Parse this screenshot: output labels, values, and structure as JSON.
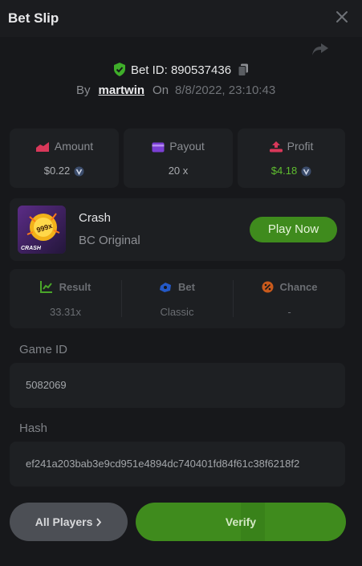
{
  "header": {
    "title": "Bet Slip"
  },
  "bet": {
    "id_text": "Bet ID: 890537436",
    "by_label": "By",
    "user": "martwin",
    "on_label": "On",
    "datetime": "8/8/2022, 23:10:43"
  },
  "stats": {
    "amount": {
      "label": "Amount",
      "value": "$0.22"
    },
    "payout": {
      "label": "Payout",
      "value": "20 x"
    },
    "profit": {
      "label": "Profit",
      "value": "$4.18"
    }
  },
  "game": {
    "name": "Crash",
    "subtitle": "BC Original",
    "thumb_badge": "999x",
    "thumb_label": "CRASH",
    "play_label": "Play Now"
  },
  "result": {
    "result": {
      "label": "Result",
      "value": "33.31x"
    },
    "bet": {
      "label": "Bet",
      "value": "Classic"
    },
    "chance": {
      "label": "Chance",
      "value": "-"
    }
  },
  "fields": {
    "game_id": {
      "label": "Game ID",
      "value": "5082069"
    },
    "hash": {
      "label": "Hash",
      "value": "ef241a203bab3e9cd951e4894dc740401fd84f61c38f6218f2"
    }
  },
  "actions": {
    "all_players": "All Players",
    "verify": "Verify"
  },
  "colors": {
    "background": "#17181b",
    "card": "#1e2023",
    "accent_green": "#3f8b1d",
    "profit_green": "#5fbd2f"
  }
}
